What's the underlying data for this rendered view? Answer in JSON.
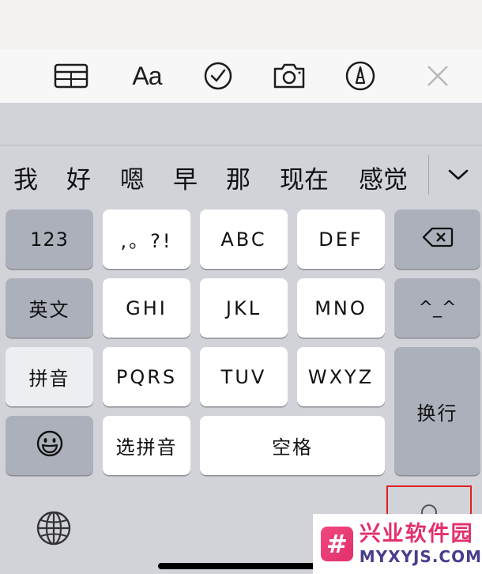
{
  "toolbar": {
    "icons": [
      "table-icon",
      "text-format-icon",
      "checklist-icon",
      "camera-icon",
      "markup-pen-icon",
      "close-icon"
    ],
    "text_format_label": "Aa"
  },
  "candidates": {
    "items": [
      "我",
      "好",
      "嗯",
      "早",
      "那",
      "现在",
      "感觉"
    ],
    "expand_icon": "chevron-down-icon"
  },
  "keyboard": {
    "row1": {
      "numbers": "123",
      "punct": ",。?!",
      "abc": "ABC",
      "def": "DEF",
      "delete_icon": "delete-icon"
    },
    "row2": {
      "english": "英文",
      "ghi": "GHI",
      "jkl": "JKL",
      "mno": "MNO",
      "emoticon": "^_^"
    },
    "row3": {
      "pinyin": "拼音",
      "pqrs": "PQRS",
      "tuv": "TUV",
      "wxyz": "WXYZ",
      "return": "换行"
    },
    "row4": {
      "emoji_icon": "emoji-icon",
      "select_pinyin": "选拼音",
      "space": "空格"
    },
    "bottom": {
      "globe_icon": "globe-icon",
      "dictation_icon": "microphone-icon"
    }
  },
  "watermark": {
    "title": "兴业软件园",
    "subtitle": "MYXYJS.COM",
    "logo_glyph": "#"
  },
  "colors": {
    "highlight": "#e02020",
    "watermark_pink": "#e2306c",
    "watermark_purple": "#4a3c8c"
  }
}
